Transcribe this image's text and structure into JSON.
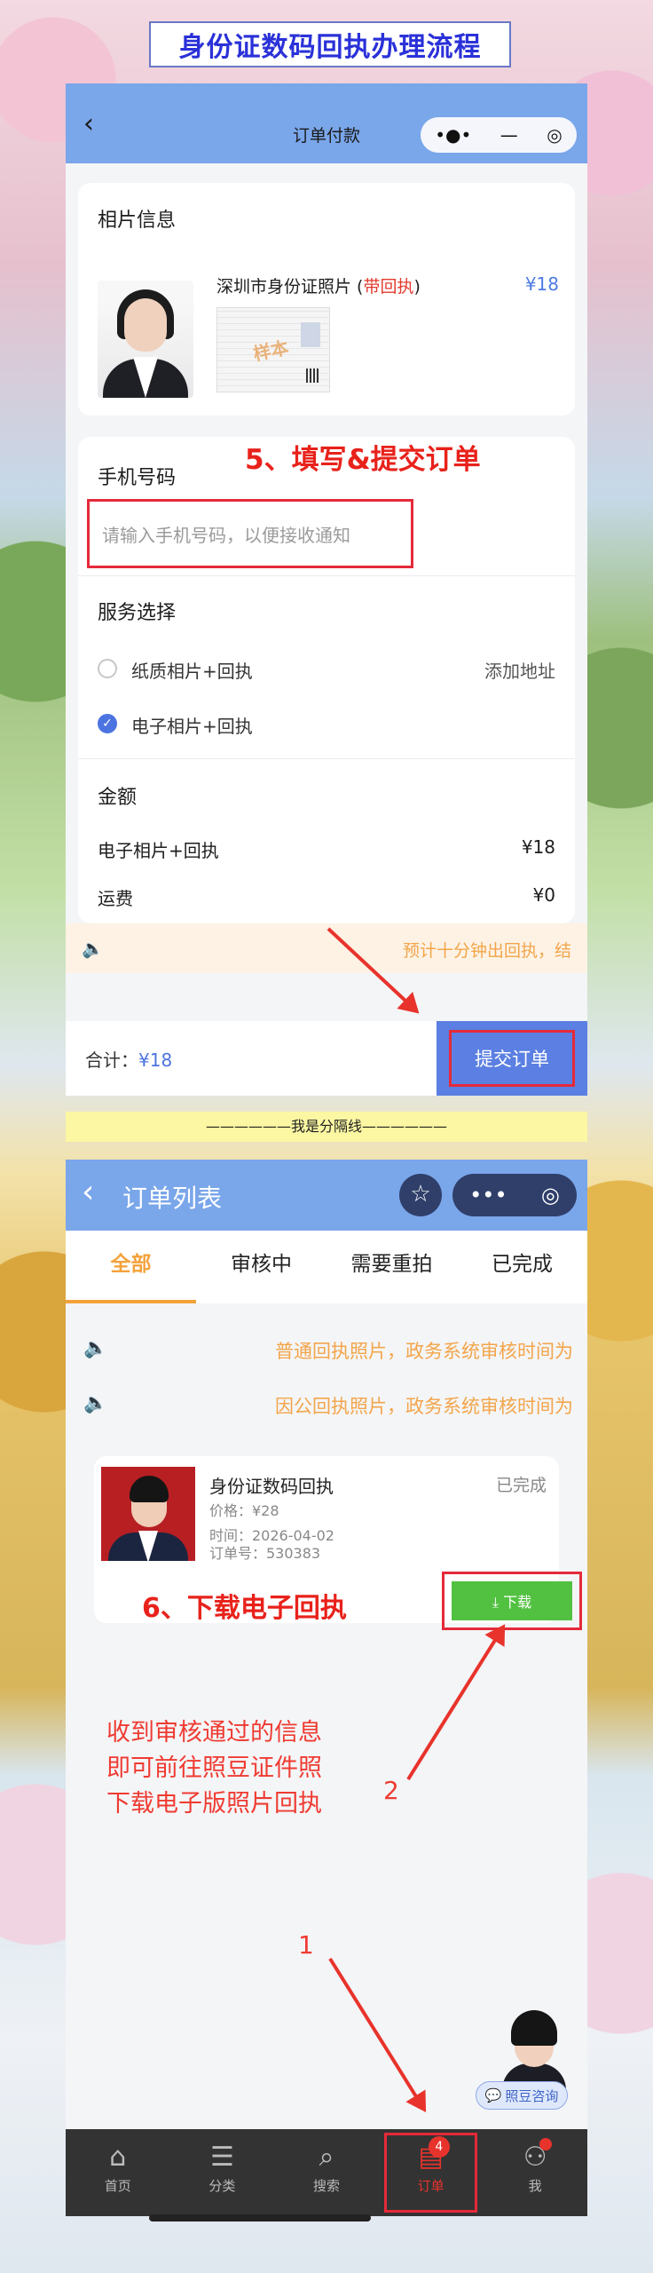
{
  "header": {
    "title": "身份证数码回执办理流程"
  },
  "panel1": {
    "nav": {
      "title": "订单付款",
      "capsule": [
        "•●•",
        "—",
        "◎"
      ]
    },
    "photo_section": {
      "label": "相片信息",
      "product_name": "深圳市身份证照片",
      "product_tag": "带回执",
      "price": "¥18",
      "sample_watermark": "样本"
    },
    "phone_section": {
      "label": "手机号码",
      "annotation": "5、填写&提交订单",
      "placeholder": "请输入手机号码，以便接收通知"
    },
    "service_section": {
      "label": "服务选择",
      "options": [
        {
          "label": "纸质相片+回执",
          "selected": false,
          "extra": "添加地址"
        },
        {
          "label": "电子相片+回执",
          "selected": true,
          "extra": ""
        }
      ]
    },
    "amount_section": {
      "label": "金额",
      "rows": [
        {
          "name": "电子相片+回执",
          "value": "¥18"
        },
        {
          "name": "运费",
          "value": "¥0"
        }
      ]
    },
    "notice": "预计十分钟出回执，结",
    "bottom": {
      "total_label": "合计：",
      "total_value": "¥18",
      "submit": "提交订单"
    }
  },
  "separator": "——————我是分隔线——————",
  "panel2": {
    "nav": {
      "title": "订单列表"
    },
    "tabs": [
      "全部",
      "审核中",
      "需要重拍",
      "已完成"
    ],
    "active_tab": 0,
    "notices": [
      "普通回执照片，政务系统审核时间为",
      "因公回执照片，政务系统审核时间为"
    ],
    "order": {
      "title": "身份证数码回执",
      "status": "已完成",
      "price": "价格：¥28",
      "time": "时间：2026-04-02",
      "order_no": "订单号：530383",
      "download": "⤓ 下载"
    },
    "annotation6": "6、下载电子回执",
    "instructions": [
      "收到审核通过的信息",
      "即可前往照豆证件照",
      "下载电子版照片回执"
    ],
    "marker1": "1",
    "marker2": "2",
    "consult": "照豆咨询",
    "tabbar": [
      {
        "label": "首页",
        "icon": "home-icon"
      },
      {
        "label": "分类",
        "icon": "category-icon"
      },
      {
        "label": "搜索",
        "icon": "search-icon"
      },
      {
        "label": "订单",
        "icon": "order-icon",
        "badge": "4"
      },
      {
        "label": "我",
        "icon": "user-icon"
      }
    ]
  }
}
